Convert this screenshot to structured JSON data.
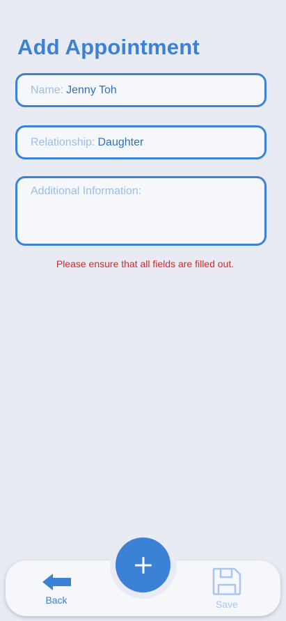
{
  "page": {
    "title": "Add Appointment"
  },
  "form": {
    "name": {
      "label": "Name:",
      "value": "Jenny Toh"
    },
    "relationship": {
      "label": "Relationship:",
      "value": "Daughter"
    },
    "additional_info": {
      "placeholder": "Additional Information:",
      "value": ""
    }
  },
  "error_message": "Please ensure that all fields are filled out.",
  "bottom_nav": {
    "back_label": "Back",
    "save_label": "Save",
    "add_icon": "plus-icon",
    "back_icon": "arrow-left-icon",
    "save_icon": "floppy-disk-icon"
  },
  "colors": {
    "accent": "#3b82d6",
    "error": "#d92626",
    "background": "#e8ebf3",
    "field_label": "#9cbde6",
    "disabled": "#a9c6ec"
  }
}
